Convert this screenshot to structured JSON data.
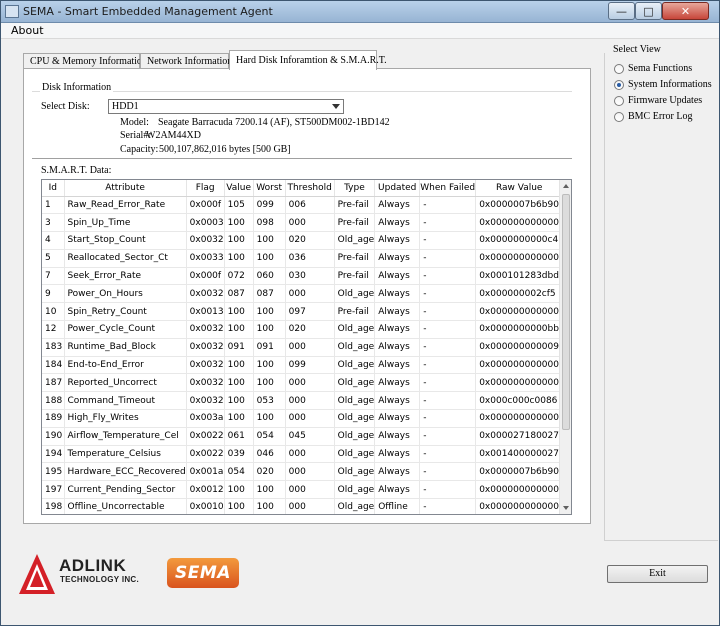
{
  "window": {
    "title": "SEMA - Smart Embedded Management Agent"
  },
  "menu": {
    "about": "About"
  },
  "tabs": [
    {
      "label": "CPU & Memory Information"
    },
    {
      "label": "Network Information"
    },
    {
      "label": "Hard Disk Inforamtion & S.M.A.R.T."
    }
  ],
  "disk_info": {
    "group_label": "Disk Information",
    "select_label": "Select Disk:",
    "selected_disk": "HDD1",
    "model_label": "Model:",
    "model": "Seagate Barracuda 7200.14 (AF), ST500DM002-1BD142",
    "serial_label": "Serial#:",
    "serial": "W2AM44XD",
    "capacity_label": "Capacity:",
    "capacity": "500,107,862,016 bytes [500 GB]"
  },
  "smart": {
    "label": "S.M.A.R.T. Data:",
    "columns": [
      "Id",
      "Attribute",
      "Flag",
      "Value",
      "Worst",
      "Threshold",
      "Type",
      "Updated",
      "When Failed",
      "Raw Value"
    ],
    "rows": [
      [
        "1",
        "Raw_Read_Error_Rate",
        "0x000f",
        "105",
        "099",
        "006",
        "Pre-fail",
        "Always",
        "-",
        "0x0000007b6b90"
      ],
      [
        "3",
        "Spin_Up_Time",
        "0x0003",
        "100",
        "098",
        "000",
        "Pre-fail",
        "Always",
        "-",
        "0x000000000000"
      ],
      [
        "4",
        "Start_Stop_Count",
        "0x0032",
        "100",
        "100",
        "020",
        "Old_age",
        "Always",
        "-",
        "0x0000000000c4"
      ],
      [
        "5",
        "Reallocated_Sector_Ct",
        "0x0033",
        "100",
        "100",
        "036",
        "Pre-fail",
        "Always",
        "-",
        "0x000000000000"
      ],
      [
        "7",
        "Seek_Error_Rate",
        "0x000f",
        "072",
        "060",
        "030",
        "Pre-fail",
        "Always",
        "-",
        "0x000101283dbd"
      ],
      [
        "9",
        "Power_On_Hours",
        "0x0032",
        "087",
        "087",
        "000",
        "Old_age",
        "Always",
        "-",
        "0x000000002cf5"
      ],
      [
        "10",
        "Spin_Retry_Count",
        "0x0013",
        "100",
        "100",
        "097",
        "Pre-fail",
        "Always",
        "-",
        "0x000000000000"
      ],
      [
        "12",
        "Power_Cycle_Count",
        "0x0032",
        "100",
        "100",
        "020",
        "Old_age",
        "Always",
        "-",
        "0x0000000000bb"
      ],
      [
        "183",
        "Runtime_Bad_Block",
        "0x0032",
        "091",
        "091",
        "000",
        "Old_age",
        "Always",
        "-",
        "0x000000000009"
      ],
      [
        "184",
        "End-to-End_Error",
        "0x0032",
        "100",
        "100",
        "099",
        "Old_age",
        "Always",
        "-",
        "0x000000000000"
      ],
      [
        "187",
        "Reported_Uncorrect",
        "0x0032",
        "100",
        "100",
        "000",
        "Old_age",
        "Always",
        "-",
        "0x000000000000"
      ],
      [
        "188",
        "Command_Timeout",
        "0x0032",
        "100",
        "053",
        "000",
        "Old_age",
        "Always",
        "-",
        "0x000c000c0086"
      ],
      [
        "189",
        "High_Fly_Writes",
        "0x003a",
        "100",
        "100",
        "000",
        "Old_age",
        "Always",
        "-",
        "0x000000000000"
      ],
      [
        "190",
        "Airflow_Temperature_Cel",
        "0x0022",
        "061",
        "054",
        "045",
        "Old_age",
        "Always",
        "-",
        "0x000027180027"
      ],
      [
        "194",
        "Temperature_Celsius",
        "0x0022",
        "039",
        "046",
        "000",
        "Old_age",
        "Always",
        "-",
        "0x001400000027"
      ],
      [
        "195",
        "Hardware_ECC_Recovered",
        "0x001a",
        "054",
        "020",
        "000",
        "Old_age",
        "Always",
        "-",
        "0x0000007b6b90"
      ],
      [
        "197",
        "Current_Pending_Sector",
        "0x0012",
        "100",
        "100",
        "000",
        "Old_age",
        "Always",
        "-",
        "0x000000000000"
      ],
      [
        "198",
        "Offline_Uncorrectable",
        "0x0010",
        "100",
        "100",
        "000",
        "Old_age",
        "Offline",
        "-",
        "0x000000000000"
      ]
    ]
  },
  "select_view": {
    "label": "Select View",
    "options": [
      {
        "label": "Sema Functions",
        "checked": false
      },
      {
        "label": "System Informations",
        "checked": true
      },
      {
        "label": "Firmware Updates",
        "checked": false
      },
      {
        "label": "BMC Error Log",
        "checked": false
      }
    ]
  },
  "buttons": {
    "exit": "Exit"
  },
  "branding": {
    "adlink": "ADLINK",
    "adlink_sub": "TECHNOLOGY INC.",
    "sema": "SEMA"
  },
  "colors": {
    "accent_orange": "#e06a25",
    "adlink_red": "#d42027",
    "title_blue": "#a8c3e0"
  }
}
